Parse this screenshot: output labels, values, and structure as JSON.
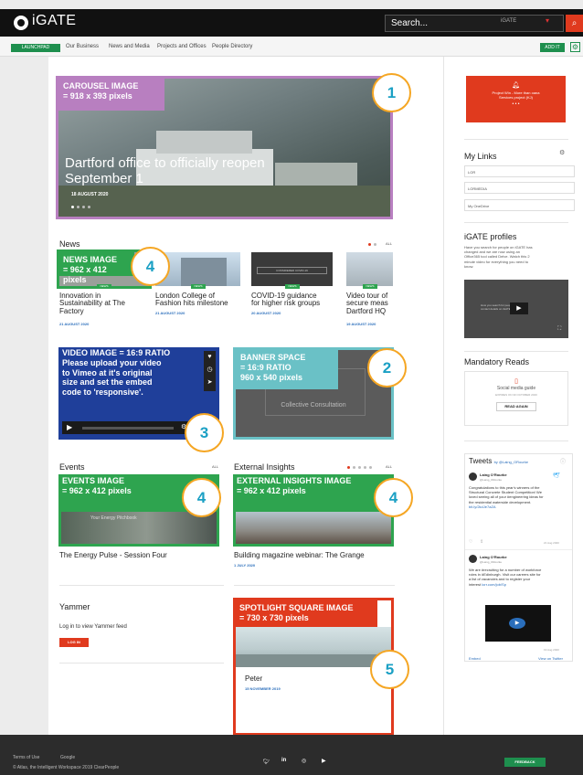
{
  "header": {
    "brand": "iGATE",
    "search_placeholder": "Search...",
    "search_scope": "iGATE",
    "launchpad": "LAUNCHPAD",
    "nav": [
      "Our Business",
      "News and Media",
      "Projects and Offices",
      "People Directory"
    ],
    "add_it": "ADD IT"
  },
  "carousel": {
    "label_line1": "CAROUSEL IMAGE",
    "label_line2": "= 918 x 393 pixels",
    "title_line1": "Dartford office to officially reopen",
    "title_line2": "September 1",
    "date": "18 AUGUST 2020",
    "badge": "1"
  },
  "news": {
    "title": "News",
    "all": "ALL",
    "tag": "NEWS",
    "image_label_line1": "NEWS IMAGE",
    "image_label_line2": "= 962 x 412 pixels",
    "badge": "4",
    "banner_text": "CONSIDERED COVID-19",
    "items": [
      {
        "title_line1": "Innovation in",
        "title_line2": "Sustainability at The",
        "title_line3": "Factory",
        "date": "21 AUGUST 2020"
      },
      {
        "title_line1": "London College of",
        "title_line2": "Fashion hits milestone",
        "title_line3": "",
        "date": "21 AUGUST 2020"
      },
      {
        "title_line1": "COVID-19 guidance",
        "title_line2": "for higher risk groups",
        "title_line3": "",
        "date": "20 AUGUST 2020"
      },
      {
        "title_line1": "Video tour of",
        "title_line2": "secure meas",
        "title_line3": "Dartford HQ",
        "date": "19 AUGUST 2020"
      }
    ]
  },
  "video": {
    "line1": "VIDEO IMAGE = 16:9 RATIO",
    "line2": "Please upload your video",
    "line3": "to Vimeo at it's original",
    "line4": "size and set the embed",
    "line5": "code to 'responsive'.",
    "badge": "3"
  },
  "banner": {
    "line1": "BANNER SPACE",
    "line2": "= 16:9 RATIO",
    "line3": "960 x 540 pixels",
    "sub_line1": "Collective Consultation",
    "badge": "2"
  },
  "events": {
    "title": "Events",
    "all": "ALL",
    "label_line1": "EVENTS IMAGE",
    "label_line2": "= 962 x 412 pixels",
    "inner_text": "Your Energy Pitchbook",
    "item_title": "The Energy Pulse - Session Four",
    "badge": "4"
  },
  "insights": {
    "title": "External Insights",
    "all": "ALL",
    "label_line1": "EXTERNAL INSIGHTS IMAGE",
    "label_line2": "= 962 x 412 pixels",
    "item_title": "Building magazine webinar: The Grange",
    "date": "1 JULY 2020",
    "badge": "4"
  },
  "yammer": {
    "title": "Yammer",
    "text": "Log in to view Yammer feed",
    "button": "LOG IN"
  },
  "spotlight": {
    "label_line1": "SPOTLIGHT SQUARE IMAGE",
    "label_line2": "= 730 x 730 pixels",
    "name": "Peter",
    "date": "15 NOVEMBER 2019",
    "badge": "5"
  },
  "sidebar": {
    "alert_line1": "Project Win - More than oana",
    "alert_line2": "Services project (KJ)",
    "my_links_title": "My Links",
    "links": [
      "LOR",
      "LORMEDIA",
      "My OneDrive"
    ],
    "profiles_title": "iGATE profiles",
    "profiles_text_1": "Have you search for people on iGATE has",
    "profiles_text_2": "changed and we are now using an",
    "profiles_text_3": "Office365 tool called Delve. Watch this 2",
    "profiles_text_4": "minute video for everything you need to",
    "profiles_text_5": "know.",
    "video_caption_1": "How you search for people and their",
    "video_caption_2": "contact details on iGATE has changed",
    "mandatory_title": "Mandatory Reads",
    "mandatory_item": "Social media guide",
    "mandatory_due": "EXPIRES ON 30 OCTOBER 2020",
    "read_again": "READ AGAIN",
    "tweets_title": "Tweets",
    "tweets_by": "by @Laing_ORourke",
    "tweet_author": "Laing O'Rourke",
    "tweet_handle": "@Laing_ORourke",
    "tweet1_line1": "Congratulations to this year's winners of the",
    "tweet1_line2": "Structural Concrete Student Competition! We",
    "tweet1_line3": "loved seeing all of your #engineering ideas for",
    "tweet1_line4": "the residential waterside development.",
    "tweet1_link": "bit.ly/2kdJe7aZA",
    "tweet1_date": "21 Aug 2020",
    "tweet2_line1": "We are #recruiting for a number of workforce",
    "tweet2_line2": "roles in #Edinburgh. Visit our careers site for",
    "tweet2_line3": "a list of vacancies and to register your",
    "tweet2_line4": "interest",
    "tweet2_link": "lorr.com/job/Sp",
    "tweet2_date": "19 Aug 2020",
    "embed": "Embed",
    "view_twitter": "View on Twitter"
  },
  "footer": {
    "terms": "Terms of Use",
    "google": "Google",
    "copyright": "© Atlas, the Intelligent Workspace 2019 ClearPeople",
    "feedback": "FEEDBACK"
  }
}
